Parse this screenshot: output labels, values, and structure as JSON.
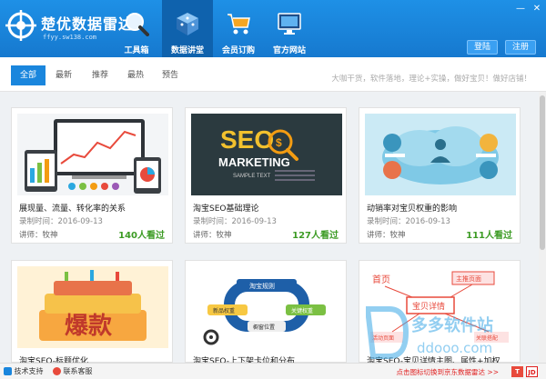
{
  "app": {
    "title": "楚优数据雷达",
    "subtitle": "ffyy.sw138.com"
  },
  "nav": [
    {
      "label": "工具箱",
      "icon": "magnifier-icon"
    },
    {
      "label": "数据讲堂",
      "icon": "cube-icon"
    },
    {
      "label": "会员订购",
      "icon": "cart-icon"
    },
    {
      "label": "官方网站",
      "icon": "monitor-icon"
    }
  ],
  "window": {
    "minimize": "—",
    "close": "✕"
  },
  "auth": {
    "login": "登陆",
    "register": "注册"
  },
  "filter": {
    "tabs": [
      "全部",
      "最新",
      "推荐",
      "最热",
      "预告"
    ],
    "slogan": "大咖干货，软件落地，理论+实操，做好宝贝！做好店铺！"
  },
  "cards": [
    {
      "title": "展现量、流量、转化率的关系",
      "date_label": "录制时间：",
      "date": "2016-09-13",
      "lecturer_label": "讲师：",
      "lecturer": "牧神",
      "views": "140人看过"
    },
    {
      "title": "淘宝SEO基础理论",
      "date_label": "录制时间：",
      "date": "2016-09-13",
      "lecturer_label": "讲师：",
      "lecturer": "牧神",
      "views": "127人看过",
      "thumb": {
        "seo": "SEO",
        "marketing": "MARKETING",
        "sample": "SAMPLE TEXT"
      }
    },
    {
      "title": "动销率对宝贝权重的影响",
      "date_label": "录制时间：",
      "date": "2016-09-13",
      "lecturer_label": "讲师：",
      "lecturer": "牧神",
      "views": "111人看过"
    },
    {
      "title": "淘宝SEO-标题优化",
      "thumb": {
        "big": "爆款"
      }
    },
    {
      "title": "淘宝SEO-上下架卡位和分布",
      "thumb": {
        "top": "淘宝规则",
        "left": "新品权重",
        "right": "关键权重",
        "bottom": "橱窗位置"
      }
    },
    {
      "title": "淘宝SEO-宝贝详情主图、属性+加权",
      "thumb": {
        "home": "首页",
        "main": "主推页面",
        "detail": "宝贝详情",
        "activity": "活动页面",
        "related": "关联搭配"
      }
    }
  ],
  "footer": {
    "support": "技术支持",
    "contact": "联系客服",
    "promo": "点击图标切换到京东数据雷达 >>",
    "badge_t": "T",
    "badge_jd": "JD"
  },
  "watermark": {
    "cn": "多多软件站",
    "url": "ddooo.com"
  },
  "colors": {
    "brand": "#1679cf",
    "accent": "#1a86dd",
    "views": "#3c9b24",
    "promo": "#e02020"
  }
}
